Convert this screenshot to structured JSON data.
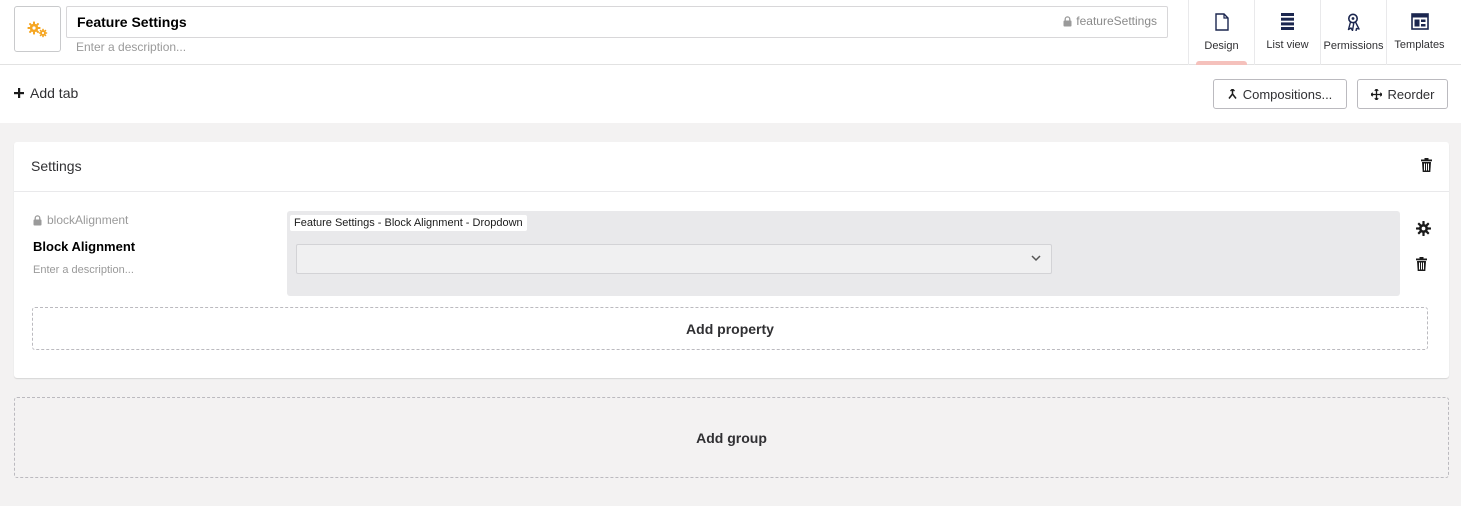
{
  "header": {
    "icon": "cogs-icon",
    "icon_color": "#f5a623",
    "name": "Feature Settings",
    "alias": "featureSettings",
    "description_placeholder": "Enter a description..."
  },
  "apps": [
    {
      "label": "Design",
      "icon": "document-icon",
      "active": true
    },
    {
      "label": "List view",
      "icon": "list-icon",
      "active": false
    },
    {
      "label": "Permissions",
      "icon": "permissions-icon",
      "active": false
    },
    {
      "label": "Templates",
      "icon": "templates-icon",
      "active": false
    }
  ],
  "toolbar": {
    "add_tab": "Add tab",
    "compositions": "Compositions...",
    "reorder": "Reorder"
  },
  "group": {
    "title": "Settings",
    "properties": [
      {
        "alias": "blockAlignment",
        "name": "Block Alignment",
        "description_placeholder": "Enter a description...",
        "editor_label": "Feature Settings - Block Alignment - Dropdown",
        "editor_value": ""
      }
    ],
    "add_property": "Add property"
  },
  "add_group": "Add group",
  "colors": {
    "accent_underline": "#f5c1bc",
    "background": "#f3f2f2",
    "text_primary": "#303033"
  }
}
